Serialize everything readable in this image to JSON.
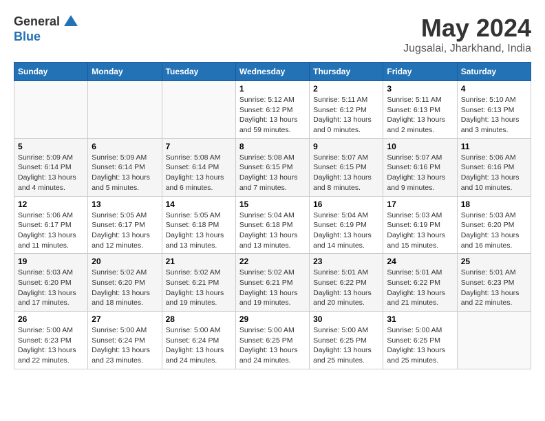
{
  "logo": {
    "general": "General",
    "blue": "Blue"
  },
  "title": "May 2024",
  "subtitle": "Jugsalai, Jharkhand, India",
  "headers": [
    "Sunday",
    "Monday",
    "Tuesday",
    "Wednesday",
    "Thursday",
    "Friday",
    "Saturday"
  ],
  "weeks": [
    [
      {
        "day": "",
        "info": ""
      },
      {
        "day": "",
        "info": ""
      },
      {
        "day": "",
        "info": ""
      },
      {
        "day": "1",
        "info": "Sunrise: 5:12 AM\nSunset: 6:12 PM\nDaylight: 13 hours\nand 59 minutes."
      },
      {
        "day": "2",
        "info": "Sunrise: 5:11 AM\nSunset: 6:12 PM\nDaylight: 13 hours\nand 0 minutes."
      },
      {
        "day": "3",
        "info": "Sunrise: 5:11 AM\nSunset: 6:13 PM\nDaylight: 13 hours\nand 2 minutes."
      },
      {
        "day": "4",
        "info": "Sunrise: 5:10 AM\nSunset: 6:13 PM\nDaylight: 13 hours\nand 3 minutes."
      }
    ],
    [
      {
        "day": "5",
        "info": "Sunrise: 5:09 AM\nSunset: 6:14 PM\nDaylight: 13 hours\nand 4 minutes."
      },
      {
        "day": "6",
        "info": "Sunrise: 5:09 AM\nSunset: 6:14 PM\nDaylight: 13 hours\nand 5 minutes."
      },
      {
        "day": "7",
        "info": "Sunrise: 5:08 AM\nSunset: 6:14 PM\nDaylight: 13 hours\nand 6 minutes."
      },
      {
        "day": "8",
        "info": "Sunrise: 5:08 AM\nSunset: 6:15 PM\nDaylight: 13 hours\nand 7 minutes."
      },
      {
        "day": "9",
        "info": "Sunrise: 5:07 AM\nSunset: 6:15 PM\nDaylight: 13 hours\nand 8 minutes."
      },
      {
        "day": "10",
        "info": "Sunrise: 5:07 AM\nSunset: 6:16 PM\nDaylight: 13 hours\nand 9 minutes."
      },
      {
        "day": "11",
        "info": "Sunrise: 5:06 AM\nSunset: 6:16 PM\nDaylight: 13 hours\nand 10 minutes."
      }
    ],
    [
      {
        "day": "12",
        "info": "Sunrise: 5:06 AM\nSunset: 6:17 PM\nDaylight: 13 hours\nand 11 minutes."
      },
      {
        "day": "13",
        "info": "Sunrise: 5:05 AM\nSunset: 6:17 PM\nDaylight: 13 hours\nand 12 minutes."
      },
      {
        "day": "14",
        "info": "Sunrise: 5:05 AM\nSunset: 6:18 PM\nDaylight: 13 hours\nand 13 minutes."
      },
      {
        "day": "15",
        "info": "Sunrise: 5:04 AM\nSunset: 6:18 PM\nDaylight: 13 hours\nand 13 minutes."
      },
      {
        "day": "16",
        "info": "Sunrise: 5:04 AM\nSunset: 6:19 PM\nDaylight: 13 hours\nand 14 minutes."
      },
      {
        "day": "17",
        "info": "Sunrise: 5:03 AM\nSunset: 6:19 PM\nDaylight: 13 hours\nand 15 minutes."
      },
      {
        "day": "18",
        "info": "Sunrise: 5:03 AM\nSunset: 6:20 PM\nDaylight: 13 hours\nand 16 minutes."
      }
    ],
    [
      {
        "day": "19",
        "info": "Sunrise: 5:03 AM\nSunset: 6:20 PM\nDaylight: 13 hours\nand 17 minutes."
      },
      {
        "day": "20",
        "info": "Sunrise: 5:02 AM\nSunset: 6:20 PM\nDaylight: 13 hours\nand 18 minutes."
      },
      {
        "day": "21",
        "info": "Sunrise: 5:02 AM\nSunset: 6:21 PM\nDaylight: 13 hours\nand 19 minutes."
      },
      {
        "day": "22",
        "info": "Sunrise: 5:02 AM\nSunset: 6:21 PM\nDaylight: 13 hours\nand 19 minutes."
      },
      {
        "day": "23",
        "info": "Sunrise: 5:01 AM\nSunset: 6:22 PM\nDaylight: 13 hours\nand 20 minutes."
      },
      {
        "day": "24",
        "info": "Sunrise: 5:01 AM\nSunset: 6:22 PM\nDaylight: 13 hours\nand 21 minutes."
      },
      {
        "day": "25",
        "info": "Sunrise: 5:01 AM\nSunset: 6:23 PM\nDaylight: 13 hours\nand 22 minutes."
      }
    ],
    [
      {
        "day": "26",
        "info": "Sunrise: 5:00 AM\nSunset: 6:23 PM\nDaylight: 13 hours\nand 22 minutes."
      },
      {
        "day": "27",
        "info": "Sunrise: 5:00 AM\nSunset: 6:24 PM\nDaylight: 13 hours\nand 23 minutes."
      },
      {
        "day": "28",
        "info": "Sunrise: 5:00 AM\nSunset: 6:24 PM\nDaylight: 13 hours\nand 24 minutes."
      },
      {
        "day": "29",
        "info": "Sunrise: 5:00 AM\nSunset: 6:25 PM\nDaylight: 13 hours\nand 24 minutes."
      },
      {
        "day": "30",
        "info": "Sunrise: 5:00 AM\nSunset: 6:25 PM\nDaylight: 13 hours\nand 25 minutes."
      },
      {
        "day": "31",
        "info": "Sunrise: 5:00 AM\nSunset: 6:25 PM\nDaylight: 13 hours\nand 25 minutes."
      },
      {
        "day": "",
        "info": ""
      }
    ]
  ]
}
